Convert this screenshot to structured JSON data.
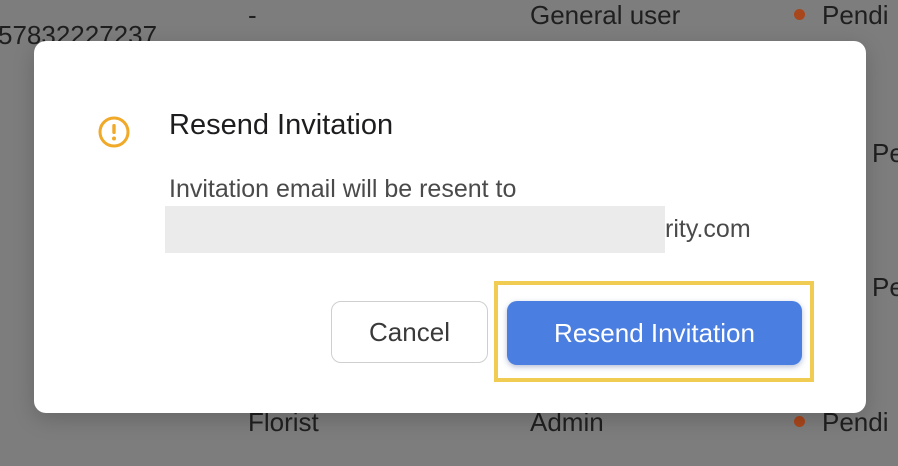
{
  "background_table": {
    "row1": {
      "phone": "57832227237",
      "name": "-",
      "role": "General user",
      "status": "Pendi"
    },
    "row2_status": "Pendi",
    "row3_status": "Pendi",
    "row4": {
      "name": "Florist",
      "role": "Admin",
      "status": "Pendi"
    }
  },
  "dialog": {
    "icon": "warning-circle-icon",
    "title": "Resend Invitation",
    "message": "Invitation email will be resent to",
    "email_visible_part": "rity.com",
    "cancel_label": "Cancel",
    "confirm_label": "Resend Invitation"
  },
  "colors": {
    "accent": "#4a7ee0",
    "warning": "#f0a928",
    "highlight": "#f0cc52",
    "status_dot": "#a8461c"
  }
}
